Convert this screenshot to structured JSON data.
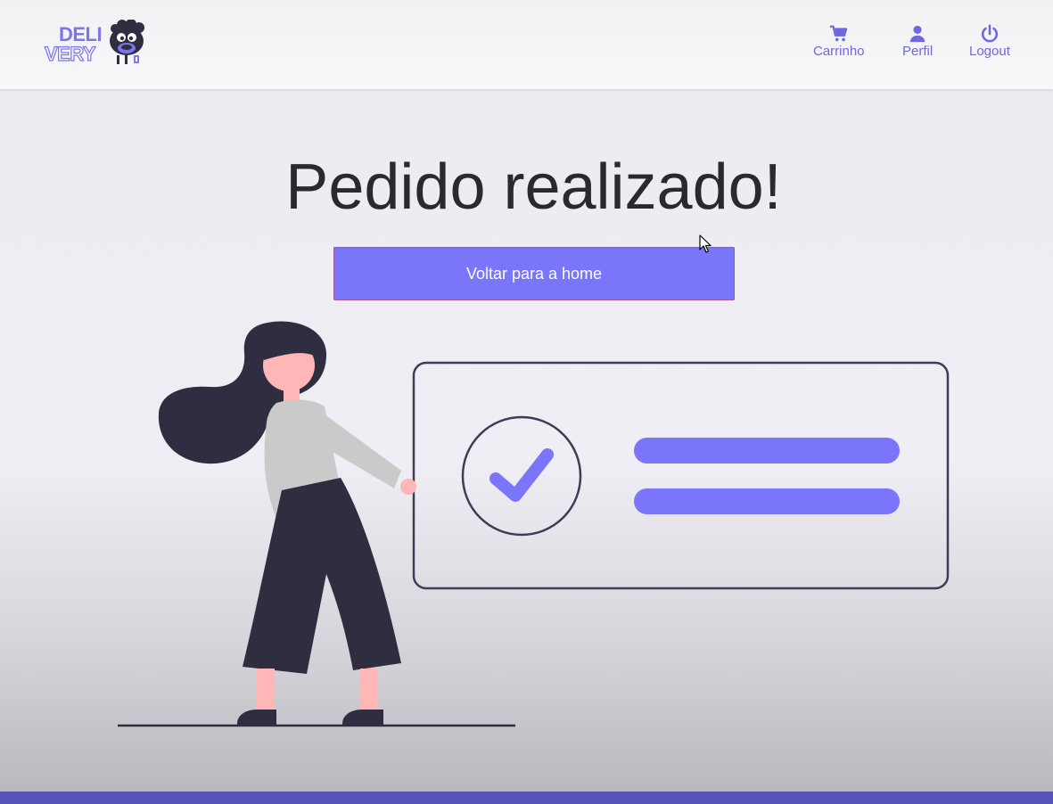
{
  "brand": {
    "logo_top": "DELI",
    "logo_bottom": "VERY"
  },
  "nav": {
    "cart": {
      "label": "Carrinho",
      "icon": "cart-icon"
    },
    "profile": {
      "label": "Perfil",
      "icon": "user-icon"
    },
    "logout": {
      "label": "Logout",
      "icon": "power-icon"
    }
  },
  "main": {
    "title": "Pedido realizado!",
    "home_button_label": "Voltar para a home"
  },
  "colors": {
    "accent": "#7a75fb",
    "nav_text": "#6e69e0",
    "title_text": "#2a2a2e",
    "footer_bar": "#5853b8",
    "illustration_dark": "#2f2e41"
  }
}
